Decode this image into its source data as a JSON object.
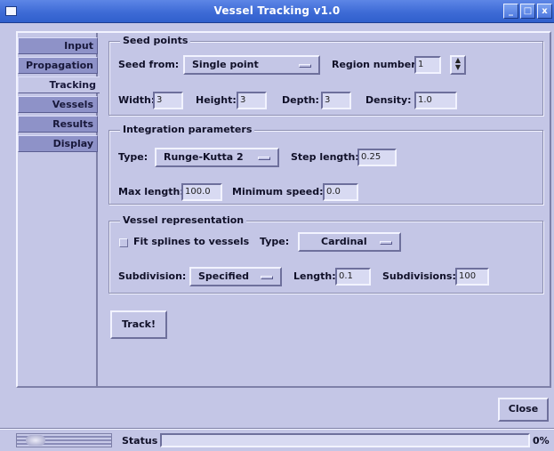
{
  "window": {
    "title": "Vessel Tracking v1.0",
    "controls": [
      "_",
      "□",
      "x"
    ]
  },
  "tabs": [
    "Input",
    "Propagation",
    "Tracking",
    "Vessels",
    "Results",
    "Display"
  ],
  "active_tab": "Tracking",
  "seed_points": {
    "legend": "Seed points",
    "seed_from_label": "Seed from:",
    "seed_from_value": "Single point",
    "region_label": "Region number:",
    "region_value": "1",
    "width_label": "Width:",
    "width_value": "3",
    "height_label": "Height:",
    "height_value": "3",
    "depth_label": "Depth:",
    "depth_value": "3",
    "density_label": "Density:",
    "density_value": "1.0"
  },
  "integration": {
    "legend": "Integration parameters",
    "type_label": "Type:",
    "type_value": "Runge-Kutta 2",
    "step_label": "Step length:",
    "step_value": "0.25",
    "max_label": "Max length:",
    "max_value": "100.0",
    "min_speed_label": "Minimum speed:",
    "min_speed_value": "0.0"
  },
  "vessel_rep": {
    "legend": "Vessel representation",
    "fit_label": "Fit splines to vessels",
    "fit_checked": false,
    "type_label": "Type:",
    "type_value": "Cardinal",
    "subdivision_label": "Subdivision:",
    "subdivision_value": "Specified",
    "length_label": "Length:",
    "length_value": "0.1",
    "subdivisions_label": "Subdivisions:",
    "subdivisions_value": "100"
  },
  "track_button": "Track!",
  "close_button": "Close",
  "status": {
    "label": "Status",
    "percent_text": "0%",
    "progress": 0
  }
}
